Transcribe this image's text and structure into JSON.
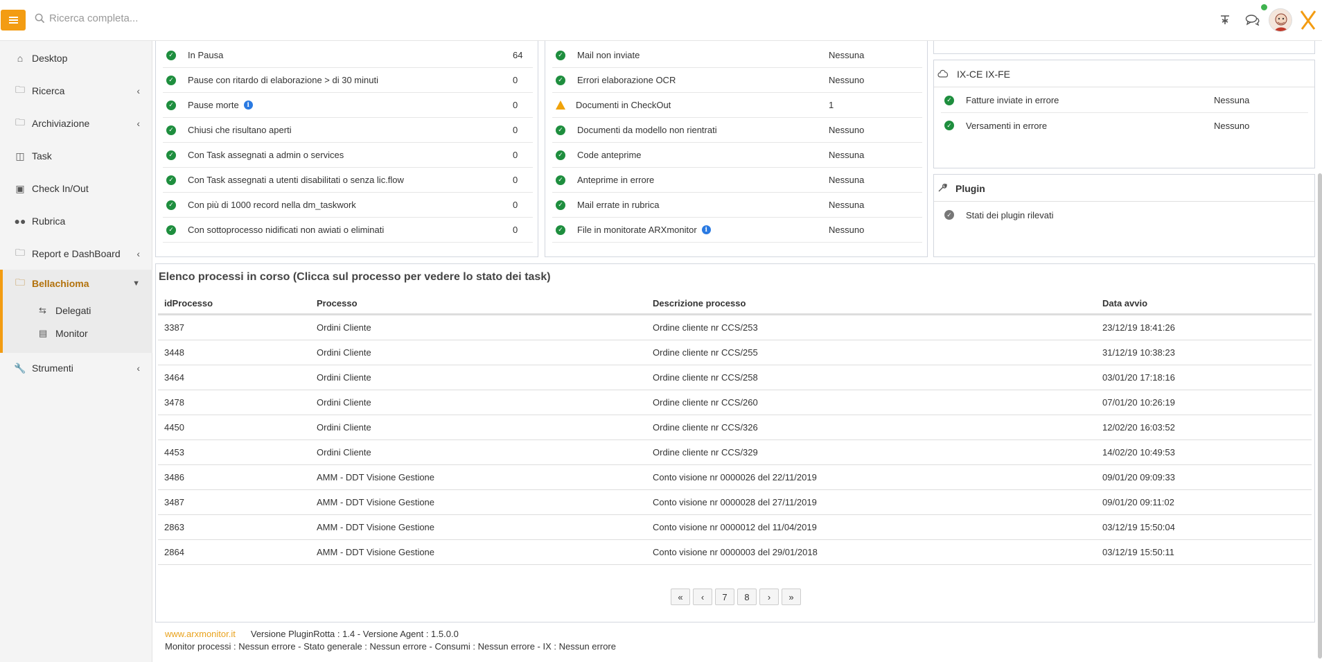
{
  "topbar": {
    "search_placeholder": "Ricerca completa...",
    "icons": [
      "menu-icon",
      "search-icon",
      "help-icon",
      "chat-icon",
      "avatar",
      "brand-logo"
    ]
  },
  "sidebar": {
    "items": [
      {
        "label": "Desktop",
        "icon": "home-icon"
      },
      {
        "label": "Ricerca",
        "icon": "folder-icon"
      },
      {
        "label": "Archiviazione",
        "icon": "folder-icon"
      },
      {
        "label": "Task",
        "icon": "columns-icon"
      },
      {
        "label": "Check In/Out",
        "icon": "archive-icon"
      },
      {
        "label": "Rubrica",
        "icon": "users-icon"
      },
      {
        "label": "Report e DashBoard",
        "icon": "folder-icon"
      },
      {
        "label": "Bellachioma",
        "icon": "folder-icon"
      },
      {
        "label": "Strumenti",
        "icon": "wrench-icon"
      }
    ],
    "sub_items": [
      {
        "label": "Delegati",
        "icon": "exchange-icon"
      },
      {
        "label": "Monitor",
        "icon": "chart-icon"
      }
    ]
  },
  "panel_left": {
    "rows": [
      {
        "label": "In Pausa",
        "value": "64"
      },
      {
        "label": "Pause con ritardo di elaborazione > di 30 minuti",
        "value": "0"
      },
      {
        "label": "Pause morte",
        "value": "0"
      },
      {
        "label": "Chiusi che risultano aperti",
        "value": "0"
      },
      {
        "label": "Con Task assegnati a admin o services",
        "value": "0"
      },
      {
        "label": "Con Task assegnati a utenti disabilitati o senza lic.flow",
        "value": "0"
      },
      {
        "label": "Con più di 1000 record nella dm_taskwork",
        "value": "0"
      },
      {
        "label": "Con sottoprocesso nidificati non awiati o eliminati",
        "value": "0"
      }
    ]
  },
  "panel_mid": {
    "rows": [
      {
        "label": "Mail non inviate",
        "value": "Nessuna"
      },
      {
        "label": "Errori elaborazione OCR",
        "value": "Nessuno"
      },
      {
        "label": "Documenti in CheckOut",
        "value": "1"
      },
      {
        "label": "Documenti da modello non rientrati",
        "value": "Nessuno"
      },
      {
        "label": "Code anteprime",
        "value": "Nessuna"
      },
      {
        "label": "Anteprime in errore",
        "value": "Nessuna"
      },
      {
        "label": "Mail errate in rubrica",
        "value": "Nessuna"
      },
      {
        "label": "File in monitorate ARXmonitor",
        "value": "Nessuno"
      }
    ]
  },
  "panel_ix": {
    "title": "IX-CE IX-FE",
    "rows": [
      {
        "label": "Fatture inviate in errore",
        "value": "Nessuna"
      },
      {
        "label": "Versamenti in errore",
        "value": "Nessuno"
      }
    ]
  },
  "panel_plugin": {
    "title": "Plugin",
    "rows": [
      {
        "label": "Stati dei plugin rilevati"
      }
    ]
  },
  "processes": {
    "title": "Elenco processi in corso (Clicca sul processo per vedere lo stato dei task)",
    "headers": [
      "idProcesso",
      "Processo",
      "Descrizione processo",
      "Data avvio"
    ],
    "rows": [
      [
        "3387",
        "Ordini Cliente",
        "Ordine cliente nr CCS/253",
        "23/12/19 18:41:26"
      ],
      [
        "3448",
        "Ordini Cliente",
        "Ordine cliente nr CCS/255",
        "31/12/19 10:38:23"
      ],
      [
        "3464",
        "Ordini Cliente",
        "Ordine cliente nr CCS/258",
        "03/01/20 17:18:16"
      ],
      [
        "3478",
        "Ordini Cliente",
        "Ordine cliente nr CCS/260",
        "07/01/20 10:26:19"
      ],
      [
        "4450",
        "Ordini Cliente",
        "Ordine cliente nr CCS/326",
        "12/02/20 16:03:52"
      ],
      [
        "4453",
        "Ordini Cliente",
        "Ordine cliente nr CCS/329",
        "14/02/20 10:49:53"
      ],
      [
        "3486",
        "AMM - DDT Visione Gestione",
        "Conto visione nr 0000026 del 22/11/2019",
        "09/01/20 09:09:33"
      ],
      [
        "3487",
        "AMM - DDT Visione Gestione",
        "Conto visione nr 0000028 del 27/11/2019",
        "09/01/20 09:11:02"
      ],
      [
        "2863",
        "AMM - DDT Visione Gestione",
        "Conto visione nr 0000012 del 11/04/2019",
        "03/12/19 15:50:04"
      ],
      [
        "2864",
        "AMM - DDT Visione Gestione",
        "Conto visione nr 0000003 del 29/01/2018",
        "03/12/19 15:50:11"
      ]
    ],
    "pager": [
      "«",
      "‹",
      "7",
      "8",
      "›",
      "»"
    ]
  },
  "footer": {
    "link": "www.arxmonitor.it",
    "version": "Versione PluginRotta : 1.4 - Versione Agent : 1.5.0.0",
    "line2": "Monitor processi : Nessun errore - Stato generale : Nessun errore - Consumi : Nessun errore - IX : Nessun errore"
  },
  "colors": {
    "accent": "#f39c12",
    "ok": "#1e8e3e",
    "warn": "#f0a30a",
    "info": "#2a7ae2"
  }
}
